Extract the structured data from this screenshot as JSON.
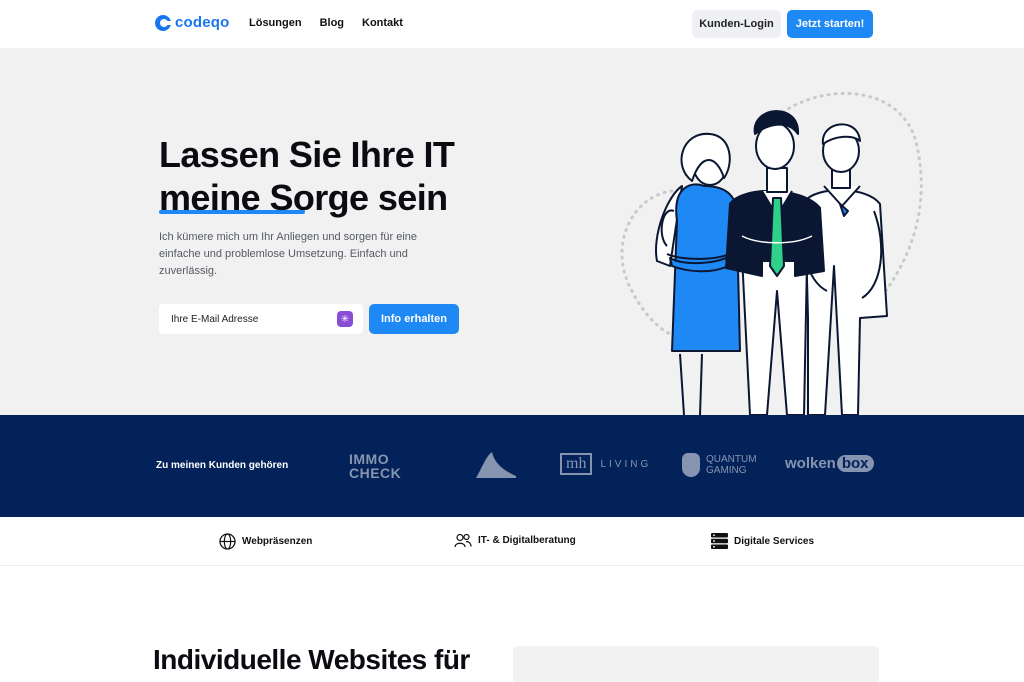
{
  "header": {
    "logo_text": "codeqo",
    "nav": [
      "Lösungen",
      "Blog",
      "Kontakt"
    ],
    "login_label": "Kunden-Login",
    "start_label": "Jetzt starten!"
  },
  "hero": {
    "title_line1": "Lassen Sie Ihre IT",
    "title_line2": "meine Sorge sein",
    "subtitle": "Ich kümere mich um Ihr Anliegen und sorgen für eine einfache und problemlose Umsetzung. Einfach und zuverlässig.",
    "email_placeholder": "Ihre E-Mail Adresse",
    "cta_label": "Info erhalten"
  },
  "clients": {
    "label": "Zu meinen Kunden gehören",
    "logos": {
      "immo_line1": "IMMO",
      "immo_line2": "CHECK",
      "mh": "mh",
      "living": "LIVING",
      "quantum_line1": "QUANTUM",
      "quantum_line2": "GAMING",
      "wolken": "wolken",
      "box": "box"
    }
  },
  "services": [
    {
      "label": "Webpräsenzen",
      "icon": "globe-icon"
    },
    {
      "label": "IT- & Digitalberatung",
      "icon": "users-icon"
    },
    {
      "label": "Digitale Services",
      "icon": "server-icon"
    }
  ],
  "section": {
    "title": "Individuelle Websites für"
  },
  "colors": {
    "accent": "#1e88f5",
    "navy": "#03225a",
    "hero_bg": "#f1f1f1"
  }
}
